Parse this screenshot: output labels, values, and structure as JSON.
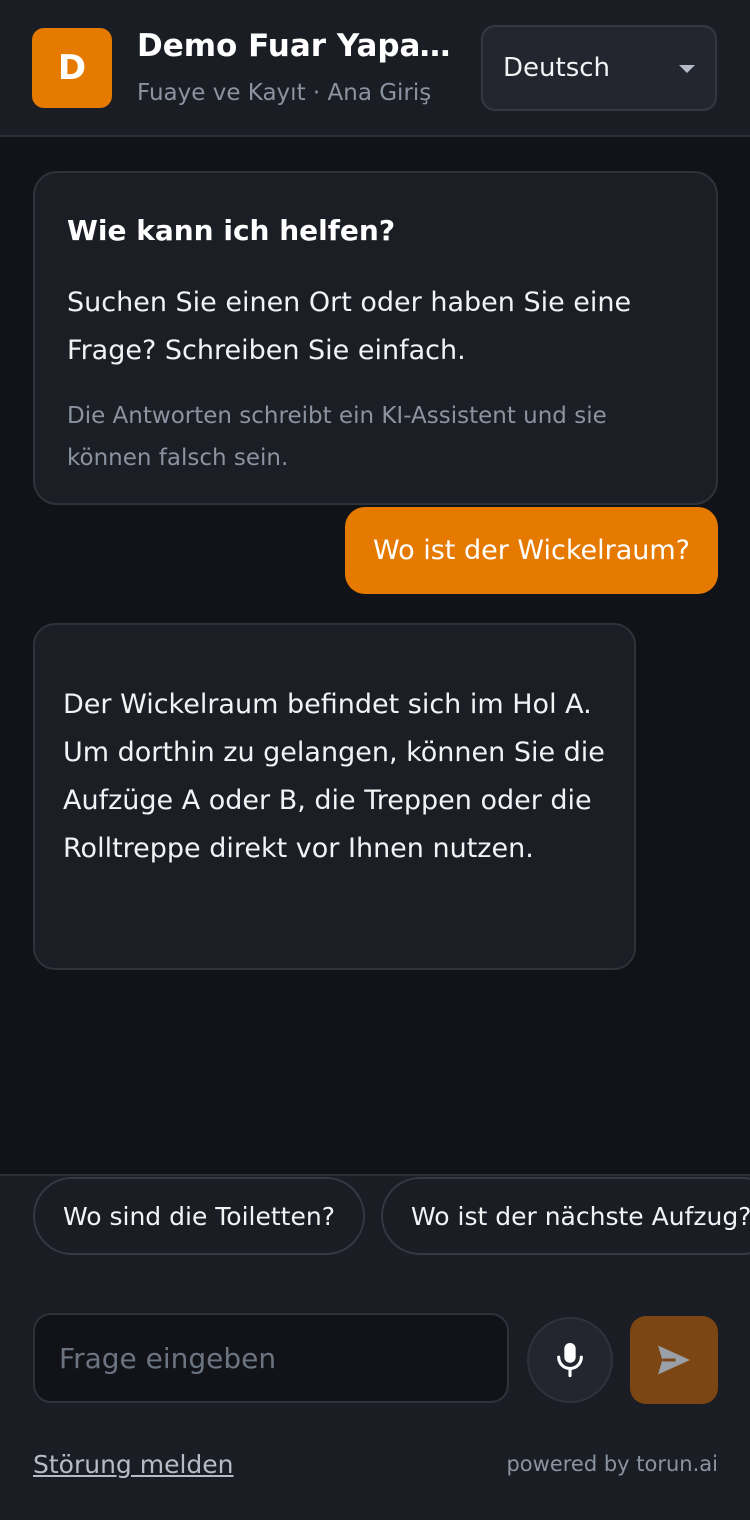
{
  "header": {
    "logo_letter": "D",
    "title": "Demo Fuar Yapay Zeka Asistanı",
    "subtitle": "Fuaye ve Kayıt · Ana Giriş",
    "language": "Deutsch"
  },
  "welcome": {
    "title": "Wie kann ich helfen?",
    "text": "Suchen Sie einen Ort oder haben Sie eine Frage? Schreiben Sie einfach.",
    "note": "Die Antworten schreibt ein KI-Assistent und sie können falsch sein."
  },
  "messages": [
    {
      "role": "user",
      "text": "Wo ist der Wickelraum?"
    },
    {
      "role": "assistant",
      "text": "Der Wickelraum befindet sich im Hol A. Um dorthin zu gelangen, können Sie die Aufzüge A oder B, die Treppen oder die Rolltreppe direkt vor Ihnen nutzen."
    }
  ],
  "suggestions": [
    "Wo sind die Toiletten?",
    "Wo ist der nächste Aufzug?"
  ],
  "composer": {
    "placeholder": "Frage eingeben"
  },
  "footer": {
    "report_label": "Störung melden",
    "powered_by": "powered by torun.ai"
  },
  "colors": {
    "accent": "#e67a00",
    "background": "#111318",
    "panel": "#1b1e25"
  }
}
